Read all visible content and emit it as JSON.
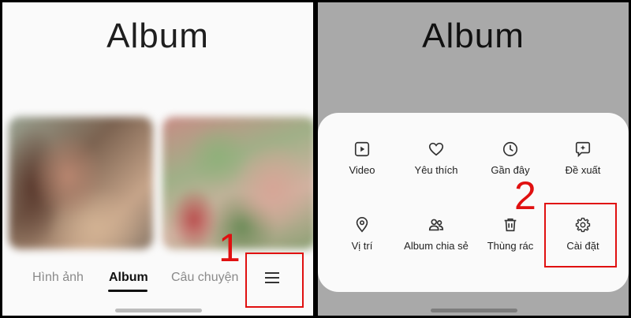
{
  "left_panel": {
    "title": "Album",
    "tabs": [
      "Hình ảnh",
      "Album",
      "Câu chuyện"
    ],
    "active_tab": "Album",
    "menu_icon": "hamburger-menu-icon",
    "step_marker": "1"
  },
  "right_panel": {
    "title": "Album",
    "step_marker": "2",
    "menu_items": [
      {
        "label": "Video",
        "icon": "video-icon"
      },
      {
        "label": "Yêu thích",
        "icon": "heart-icon"
      },
      {
        "label": "Gần đây",
        "icon": "clock-icon"
      },
      {
        "label": "Đề xuất",
        "icon": "suggestion-icon"
      },
      {
        "label": "Vị trí",
        "icon": "location-pin-icon"
      },
      {
        "label": "Album chia sẻ",
        "icon": "shared-people-icon"
      },
      {
        "label": "Thùng rác",
        "icon": "trash-icon"
      },
      {
        "label": "Cài đặt",
        "icon": "gear-icon"
      }
    ]
  },
  "colors": {
    "annotation": "#e01010",
    "overlay": "#a9a9a9",
    "sheet": "#fafafa"
  }
}
